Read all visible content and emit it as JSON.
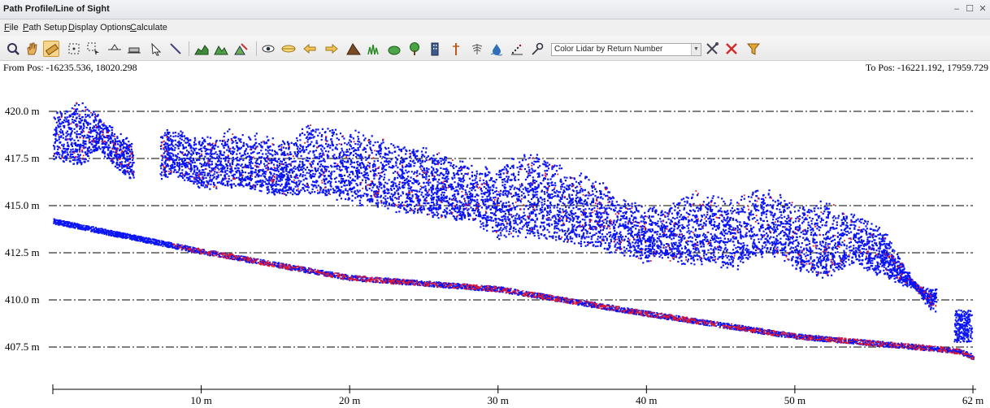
{
  "window": {
    "title": "Path Profile/Line of Sight",
    "controls": [
      "–",
      "☐",
      "✕"
    ]
  },
  "menu": [
    "File",
    "Path Setup",
    "Display Options",
    "Calculate"
  ],
  "toolbar": {
    "color_mode": "Color Lidar by Return Number",
    "icons": [
      "zoom-icon",
      "pan-hand-icon",
      "measure-ruler-icon",
      "select-points-icon",
      "select-region-icon",
      "horizon-icon",
      "flatten-icon",
      "pointer-icon",
      "line-tool-icon",
      "terrain-chart-icon",
      "terrain-mountains-icon",
      "route-edit-icon",
      "eye-view-icon",
      "fresnel-icon",
      "swap-left-icon",
      "swap-right-icon",
      "mountain-icon",
      "grass-icon",
      "bush-icon",
      "tree-icon",
      "building-icon",
      "tower-icon",
      "antenna-icon",
      "water-drop-icon",
      "dotted-line-icon",
      "key-icon",
      "settings-tools-icon",
      "clear-x-icon",
      "filter-funnel-icon"
    ],
    "active_index": 2
  },
  "positions": {
    "from": "From Pos: -16235.536, 18020.298",
    "to": "To Pos: -16221.192, 17959.729"
  },
  "colors": {
    "first_return": "#0b14f2",
    "last_return": "#e3162c",
    "gridline": "#000000"
  },
  "chart_data": {
    "type": "scatter",
    "title": "",
    "xlabel": "",
    "ylabel": "",
    "xlim": [
      0,
      62
    ],
    "ylim": [
      405.5,
      421.0
    ],
    "grid": "horizontal dash-dot lines at each y tick",
    "y_ticks": [
      407.5,
      410.0,
      412.5,
      415.0,
      417.5,
      420.0
    ],
    "y_tick_labels": [
      "407.5 m",
      "410.0 m",
      "412.5 m",
      "415.0 m",
      "417.5 m",
      "420.0 m"
    ],
    "x_ticks": [
      10,
      20,
      30,
      40,
      50,
      62
    ],
    "x_tick_labels": [
      "10 m",
      "20 m",
      "30 m",
      "40 m",
      "50 m",
      "62 m"
    ],
    "series": [
      {
        "name": "",
        "color": "#0b14f2",
        "ground": {
          "x": [
            0,
            10,
            20,
            30,
            40,
            50,
            60,
            61,
            62
          ],
          "y": [
            414.2,
            412.6,
            411.2,
            410.6,
            409.3,
            408.1,
            407.4,
            407.3,
            407.0
          ]
        },
        "canopy_top": {
          "x": [
            0,
            2,
            3,
            5,
            5.5,
            7,
            8,
            10,
            12,
            16,
            17,
            20,
            22,
            25,
            28,
            30,
            31,
            33,
            35,
            37,
            38,
            40,
            41,
            43,
            44,
            46,
            47,
            49,
            50,
            52,
            54,
            56,
            59,
            61,
            62
          ],
          "y": [
            420.0,
            420.5,
            419.8,
            418.5,
            418.0,
            418.8,
            419.0,
            418.6,
            419.0,
            418.4,
            419.4,
            419.0,
            418.5,
            418.0,
            417.2,
            416.8,
            417.9,
            417.6,
            416.9,
            416.2,
            415.3,
            415.1,
            414.8,
            415.8,
            415.5,
            415.3,
            415.9,
            415.7,
            415.0,
            415.2,
            414.6,
            413.6,
            409.6,
            409.0,
            408.0
          ]
        },
        "canopy_bottom": {
          "x": [
            0,
            2,
            3,
            5,
            7,
            8,
            10,
            12,
            16,
            17,
            20,
            22,
            25,
            28,
            30,
            31,
            33,
            35,
            37,
            38,
            40,
            41,
            43,
            44,
            46,
            47,
            49,
            50,
            52,
            54,
            56,
            59
          ],
          "y": [
            417.6,
            417.2,
            418.0,
            416.6,
            416.4,
            416.8,
            416.0,
            416.1,
            415.6,
            415.9,
            415.3,
            415.0,
            414.6,
            414.2,
            413.4,
            413.5,
            413.4,
            413.0,
            412.8,
            412.6,
            412.1,
            412.4,
            411.9,
            412.1,
            411.7,
            412.3,
            412.4,
            411.8,
            411.3,
            412.1,
            411.3,
            410.5
          ]
        }
      },
      {
        "name": "",
        "color": "#e3162c",
        "ground": {
          "x": [
            10,
            20,
            30,
            40,
            50,
            60
          ],
          "y": [
            412.6,
            411.2,
            410.6,
            409.3,
            408.1,
            407.4
          ]
        }
      }
    ]
  }
}
